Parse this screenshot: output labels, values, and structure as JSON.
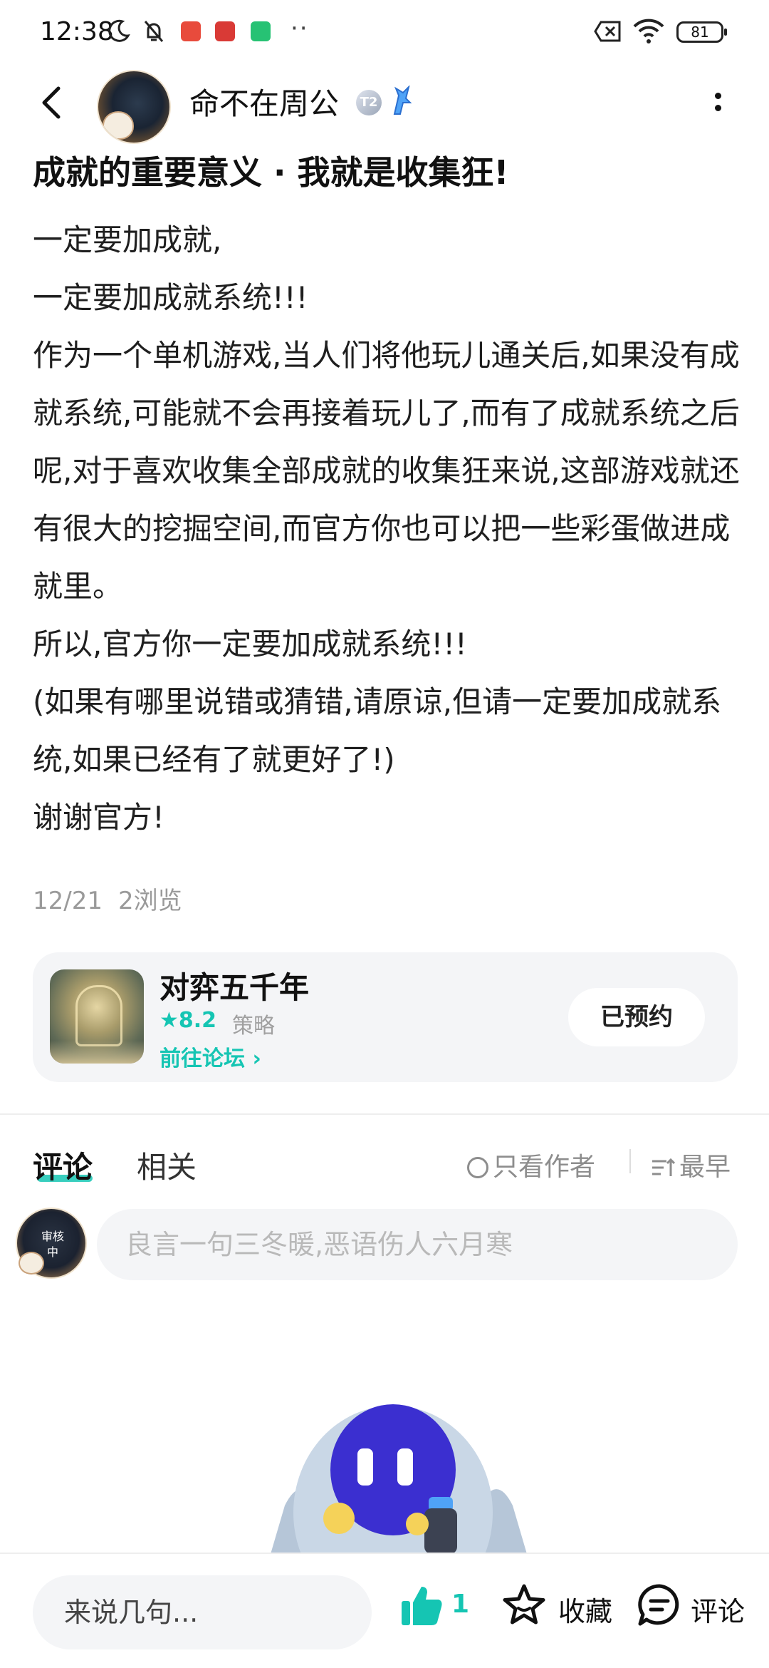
{
  "status_bar": {
    "time": "12:38",
    "battery": "81"
  },
  "header": {
    "author_name": "命不在周公",
    "level_badge": "T2"
  },
  "post": {
    "title": "成就的重要意义 · 我就是收集狂!",
    "paragraphs": [
      "一定要加成就,",
      "一定要加成就系统!!!",
      "作为一个单机游戏,当人们将他玩儿通关后,如果没有成就系统,可能就不会再接着玩儿了,而有了成就系统之后呢,对于喜欢收集全部成就的收集狂来说,这部游戏就还有很大的挖掘空间,而官方你也可以把一些彩蛋做进成就里。",
      "所以,官方你一定要加成就系统!!!",
      "(如果有哪里说错或猜错,请原谅,但请一定要加成就系统,如果已经有了就更好了!)",
      "谢谢官方!"
    ],
    "date": "12/21",
    "views": "2浏览"
  },
  "game_card": {
    "name": "对弈五千年",
    "rating": "★8.2",
    "genre": "策略",
    "forum_link": "前往论坛 ›",
    "reserve_label": "已预约"
  },
  "comments": {
    "tab_comments": "评论",
    "tab_related": "相关",
    "author_only": "只看作者",
    "sort": "最早",
    "avatar_status": "审核中",
    "input_placeholder": "良言一句三冬暖,恶语伤人六月寒"
  },
  "bottom_bar": {
    "input_placeholder": "来说几句...",
    "like_count": "1",
    "favorite_label": "收藏",
    "comment_label": "评论"
  },
  "colors": {
    "accent": "#15c5b3",
    "card_bg": "#f4f5f7",
    "mascot_body": "#c9d7e6",
    "mascot_head": "#3b2fd0"
  }
}
